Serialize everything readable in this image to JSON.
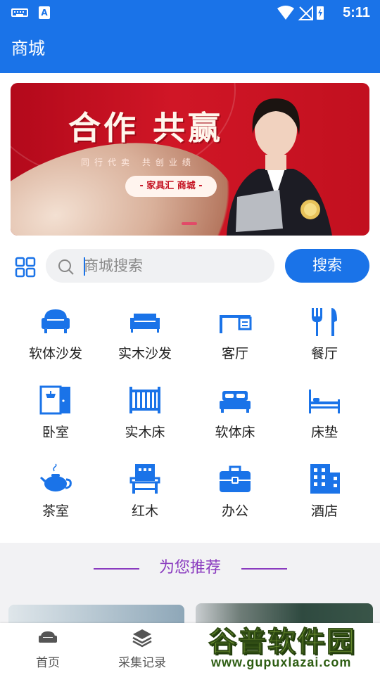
{
  "status_bar": {
    "time": "5:11",
    "notification_icon_letter": "A"
  },
  "app_bar": {
    "title": "商城"
  },
  "banner": {
    "headline": "合作  共赢",
    "subline": "同行代卖  共创业绩",
    "pill_text": "- 家具汇 商城 -"
  },
  "search": {
    "placeholder": "商城搜索",
    "value": "",
    "button_label": "搜索"
  },
  "categories": [
    {
      "label": "软体沙发",
      "icon": "sofa-icon"
    },
    {
      "label": "实木沙发",
      "icon": "wood-sofa-icon"
    },
    {
      "label": "客厅",
      "icon": "desk-icon"
    },
    {
      "label": "餐厅",
      "icon": "fork-knife-icon"
    },
    {
      "label": "卧室",
      "icon": "wardrobe-icon"
    },
    {
      "label": "实木床",
      "icon": "wood-bed-icon"
    },
    {
      "label": "软体床",
      "icon": "double-bed-icon"
    },
    {
      "label": "床垫",
      "icon": "mattress-icon"
    },
    {
      "label": "茶室",
      "icon": "teapot-icon"
    },
    {
      "label": "红木",
      "icon": "armchair-icon"
    },
    {
      "label": "办公",
      "icon": "briefcase-icon"
    },
    {
      "label": "酒店",
      "icon": "building-icon"
    }
  ],
  "recommend": {
    "title": "为您推荐"
  },
  "bottom_nav": [
    {
      "label": "首页",
      "icon": "home-sofa-icon"
    },
    {
      "label": "采集记录",
      "icon": "layers-icon"
    }
  ],
  "watermark": {
    "cn": "谷普软件园",
    "en": "www.gupuxlazai.com"
  },
  "colors": {
    "primary": "#1a73e8",
    "recommend_title": "#8a3bbf",
    "banner_red": "#c8101f"
  }
}
